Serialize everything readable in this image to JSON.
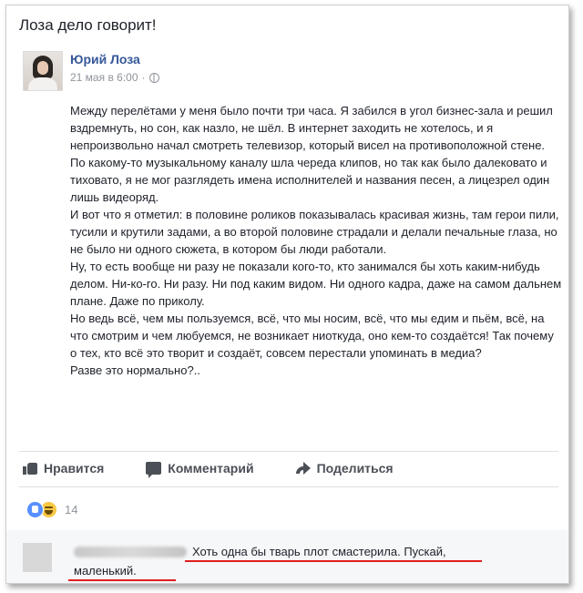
{
  "headline": "Лоза дело говорит!",
  "post": {
    "author": "Юрий Лоза",
    "timestamp": "21 мая в 6:00",
    "privacy_icon": "globe-icon",
    "paragraphs": [
      "Между перелётами у меня было почти три часа. Я забился в угол бизнес-зала и решил вздремнуть, но сон, как назло, не шёл. В интернет заходить не хотелось, и я непроизвольно начал смотреть телевизор, который висел на противоположной стене. По какому-то музыкальному каналу шла череда клипов, но так как было далековато и тиховато, я не мог разглядеть имена исполнителей и названия песен, а лицезрел один лишь видеоряд.",
      "И вот что я отметил: в половине роликов показывалась красивая жизнь, там герои пили, тусили и крутили задами, а во второй половине страдали и делали печальные глаза, но не было ни одного сюжета, в котором бы люди работали.",
      "Ну, то есть вообще ни разу не показали кого-то, кто занимался бы хоть каким-нибудь делом. Ни-ко-го. Ни разу. Ни под каким видом. Ни одного кадра, даже на самом дальнем плане. Даже по приколу.",
      "Но ведь всё, чем мы пользуемся, всё, что мы носим, всё, что мы едим и пьём, всё, на что смотрим и чем любуемся, не возникает ниоткуда, оно кем-то создаётся! Так почему о тех, кто всё это творит и создаёт, совсем перестали упоминать в медиа?",
      "Разве это нормально?.."
    ]
  },
  "actions": {
    "like_label": "Нравится",
    "comment_label": "Комментарий",
    "share_label": "Поделиться"
  },
  "reactions": {
    "types": [
      "like-icon",
      "haha-icon"
    ],
    "count": "14"
  },
  "comment": {
    "text": "Хоть одна бы тварь плот смастерила. Пускай, маленький.",
    "highlight_color": "#e01e1e"
  },
  "colors": {
    "author_link": "#365899",
    "text": "#1d2129",
    "muted": "#90949c"
  }
}
